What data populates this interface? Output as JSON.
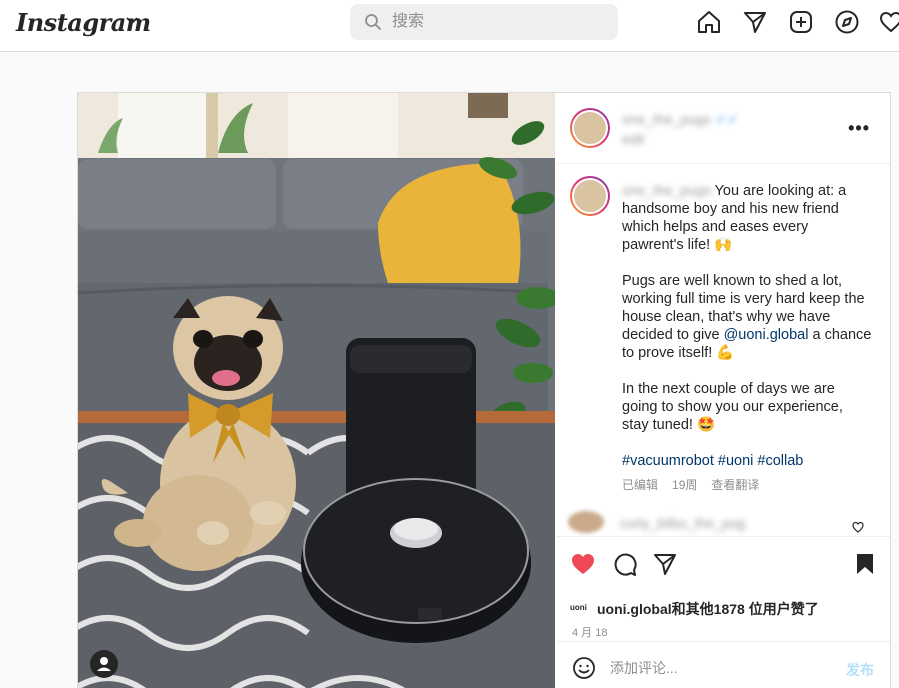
{
  "app": {
    "logo": "Instagram"
  },
  "search": {
    "placeholder": "搜索"
  },
  "nav_icons": [
    "home-icon",
    "direct-message-icon",
    "new-post-icon",
    "explore-icon",
    "activity-heart-icon"
  ],
  "post": {
    "header_username": "one_the_pugs",
    "header_location": "edit",
    "caption_username": "one_the_pugs",
    "caption_lines": {
      "p1": "You are looking at: a handsome boy and his new friend which helps and eases every pawrent's life! 🙌",
      "p2_before": "Pugs are well known to shed a lot, working full time is very hard keep the house clean, that's why we have decided to give ",
      "p2_mention": "@uoni.global",
      "p2_after": " a chance to prove itself! 💪",
      "p3": "In the next couple of days we are going to show you our experience, stay tuned! 🤩",
      "tags": "#vacuumrobot #uoni #collab"
    },
    "meta": {
      "edited": "已编辑",
      "age": "19周",
      "translate": "查看翻译"
    },
    "comment_blurred": "curly_bilbo_the_pug",
    "likes": {
      "mini_brand": "uoni",
      "text": "uoni.global和其他1878 位用户赞了"
    },
    "date": "4 月 18",
    "add_comment": {
      "placeholder": "添加评论...",
      "post_label": "发布"
    }
  },
  "colors": {
    "like_red": "#ed4956",
    "link": "#00376b",
    "post_btn": "#b2dffc"
  }
}
